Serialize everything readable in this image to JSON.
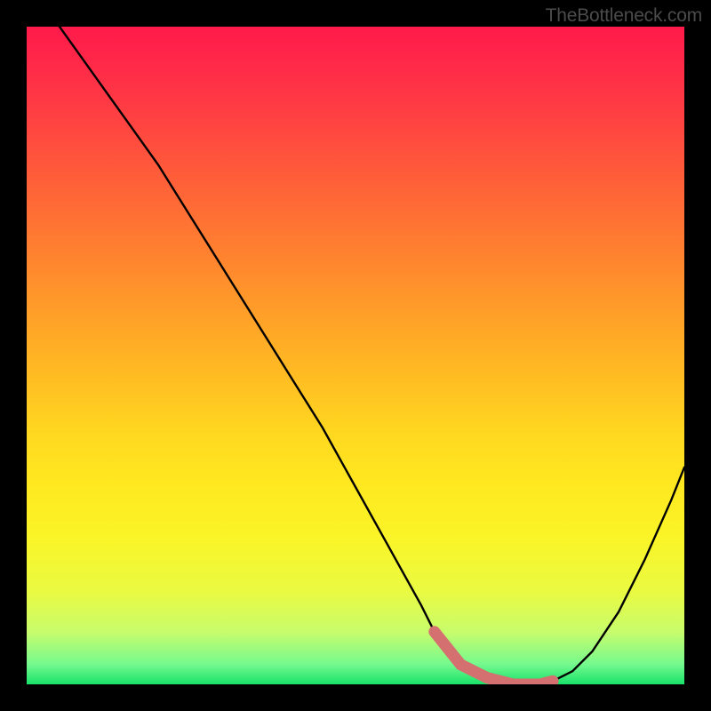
{
  "watermark": "TheBottleneck.com",
  "colors": {
    "curve": "#000000",
    "marker": "#d4706f",
    "frame_bg": "#000000",
    "gradient_top": "#ff1a4a",
    "gradient_bottom": "#18e26a"
  },
  "chart_data": {
    "type": "line",
    "title": "",
    "xlabel": "",
    "ylabel": "",
    "xlim": [
      0,
      100
    ],
    "ylim": [
      0,
      100
    ],
    "grid": false,
    "series": [
      {
        "name": "bottleneck-curve",
        "x": [
          5,
          10,
          15,
          20,
          25,
          30,
          35,
          40,
          45,
          50,
          55,
          60,
          62,
          66,
          70,
          74,
          78,
          80,
          83,
          86,
          90,
          94,
          98,
          100
        ],
        "values": [
          100,
          93,
          86,
          79,
          71,
          63,
          55,
          47,
          39,
          30,
          21,
          12,
          8,
          3,
          1,
          0,
          0,
          0.5,
          2,
          5,
          11,
          19,
          28,
          33
        ]
      },
      {
        "name": "optimal-band",
        "x": [
          62,
          66,
          70,
          74,
          78,
          80
        ],
        "values": [
          8,
          3,
          1,
          0,
          0,
          0.5
        ]
      }
    ],
    "annotations": []
  }
}
